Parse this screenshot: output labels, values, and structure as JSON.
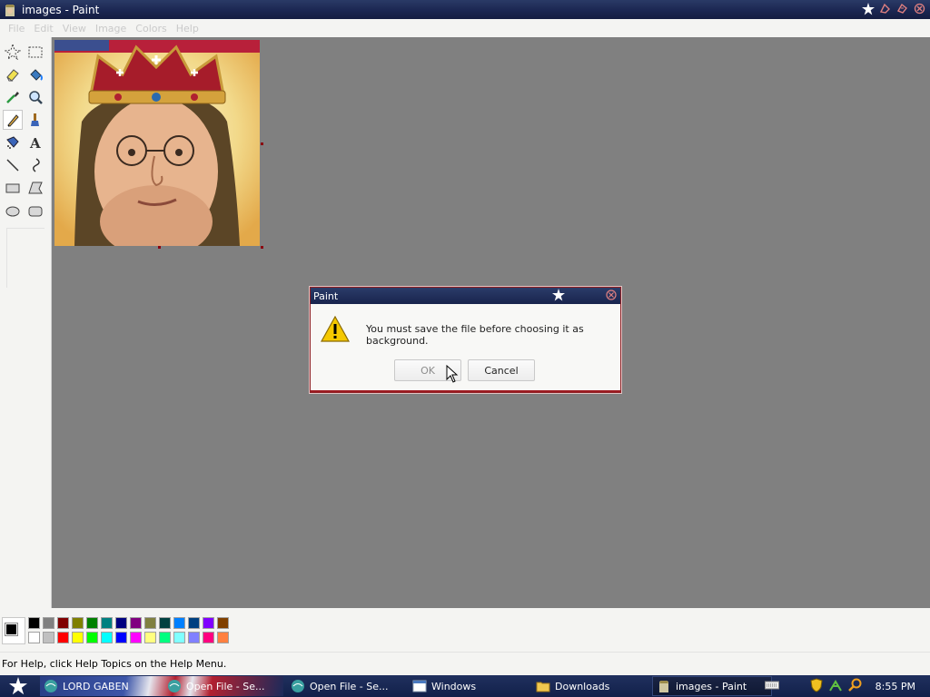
{
  "window": {
    "title": "images - Paint"
  },
  "menu": [
    "File",
    "Edit",
    "View",
    "Image",
    "Colors",
    "Help"
  ],
  "tools": [
    {
      "icon": "free-form-select-icon"
    },
    {
      "icon": "rect-select-icon"
    },
    {
      "icon": "eraser-icon"
    },
    {
      "icon": "fill-icon"
    },
    {
      "icon": "color-picker-icon"
    },
    {
      "icon": "magnifier-icon"
    },
    {
      "icon": "pencil-icon"
    },
    {
      "icon": "brush-icon"
    },
    {
      "icon": "airbrush-icon"
    },
    {
      "icon": "text-icon"
    },
    {
      "icon": "line-icon"
    },
    {
      "icon": "curve-icon"
    },
    {
      "icon": "rectangle-icon"
    },
    {
      "icon": "polygon-icon"
    },
    {
      "icon": "ellipse-icon"
    },
    {
      "icon": "rounded-rect-icon"
    }
  ],
  "canvas": {
    "image_description": "portrait with crown"
  },
  "dialog": {
    "title": "Paint",
    "message": "You must save the file before choosing it as background.",
    "ok_label": "OK",
    "cancel_label": "Cancel"
  },
  "palette": {
    "top_row": [
      "#000000",
      "#808080",
      "#800000",
      "#808000",
      "#008000",
      "#008080",
      "#000080",
      "#800080",
      "#808040",
      "#004040",
      "#0080ff",
      "#004080",
      "#8000ff",
      "#804000"
    ],
    "bottom_row": [
      "#ffffff",
      "#c0c0c0",
      "#ff0000",
      "#ffff00",
      "#00ff00",
      "#00ffff",
      "#0000ff",
      "#ff00ff",
      "#ffff80",
      "#00ff80",
      "#80ffff",
      "#8080ff",
      "#ff0080",
      "#ff8040"
    ]
  },
  "status": {
    "help_text": "For Help, click Help Topics on the Help Menu."
  },
  "taskbar": {
    "items": [
      {
        "label": "LORD GABEN",
        "icon": "browser-icon"
      },
      {
        "label": "Open File - Se...",
        "icon": "browser-icon"
      },
      {
        "label": "Open File - Se...",
        "icon": "browser-icon"
      },
      {
        "label": "Windows",
        "icon": "window-icon"
      },
      {
        "label": "Downloads",
        "icon": "folder-icon"
      },
      {
        "label": "images - Paint",
        "icon": "paint-icon"
      }
    ],
    "clock": "8:55 PM"
  }
}
